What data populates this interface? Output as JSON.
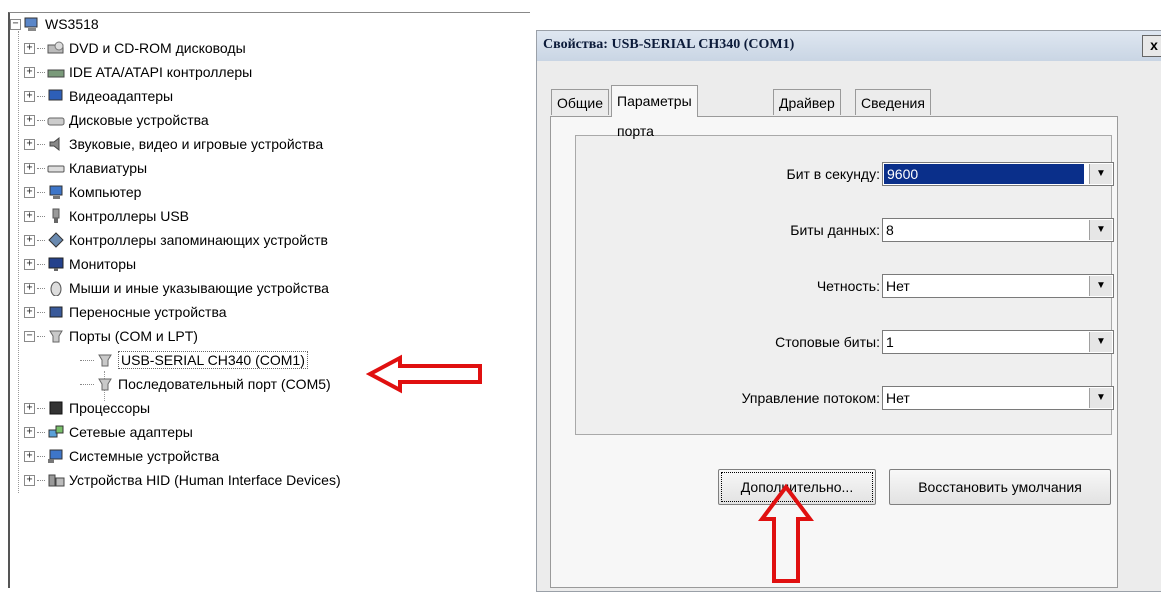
{
  "tree": {
    "root_label": "WS3518",
    "items": [
      {
        "label": "DVD и CD-ROM дисководы",
        "icon": "disc-drive-icon"
      },
      {
        "label": "IDE ATA/ATAPI контроллеры",
        "icon": "ide-controller-icon"
      },
      {
        "label": "Видеоадаптеры",
        "icon": "display-adapter-icon"
      },
      {
        "label": "Дисковые устройства",
        "icon": "disk-drive-icon"
      },
      {
        "label": "Звуковые, видео и игровые устройства",
        "icon": "speaker-icon"
      },
      {
        "label": "Клавиатуры",
        "icon": "keyboard-icon"
      },
      {
        "label": "Компьютер",
        "icon": "computer-icon"
      },
      {
        "label": "Контроллеры USB",
        "icon": "usb-icon"
      },
      {
        "label": "Контроллеры запоминающих устройств",
        "icon": "storage-controller-icon"
      },
      {
        "label": "Мониторы",
        "icon": "monitor-icon"
      },
      {
        "label": "Мыши и иные указывающие устройства",
        "icon": "mouse-icon"
      },
      {
        "label": "Переносные устройства",
        "icon": "portable-device-icon"
      },
      {
        "label": "Порты (COM и LPT)",
        "icon": "port-icon"
      }
    ],
    "port_children": [
      {
        "label": "USB-SERIAL CH340 (COM1)",
        "icon": "port-icon"
      },
      {
        "label": "Последовательный порт (COM5)",
        "icon": "port-icon"
      }
    ],
    "items_after": [
      {
        "label": "Процессоры",
        "icon": "processor-icon"
      },
      {
        "label": "Сетевые адаптеры",
        "icon": "network-icon"
      },
      {
        "label": "Системные устройства",
        "icon": "system-device-icon"
      },
      {
        "label": "Устройства HID (Human Interface Devices)",
        "icon": "hid-icon"
      }
    ]
  },
  "dialog": {
    "title": "Свойства: USB-SERIAL CH340 (COM1)",
    "close": "x",
    "tabs": [
      "Общие",
      "Параметры порта",
      "Драйвер",
      "Сведения"
    ],
    "active_tab": "Параметры порта",
    "fields": [
      {
        "label": "Бит в секунду:",
        "value": "9600"
      },
      {
        "label": "Биты данных:",
        "value": "8"
      },
      {
        "label": "Четность:",
        "value": "Нет"
      },
      {
        "label": "Стоповые биты:",
        "value": "1"
      },
      {
        "label": "Управление потоком:",
        "value": "Нет"
      }
    ],
    "advanced_button": "Дополнительно...",
    "restore_button": "Восстановить умолчания"
  },
  "colors": {
    "annotation_arrow": "#e01010",
    "selection": "#0a2f8a"
  }
}
